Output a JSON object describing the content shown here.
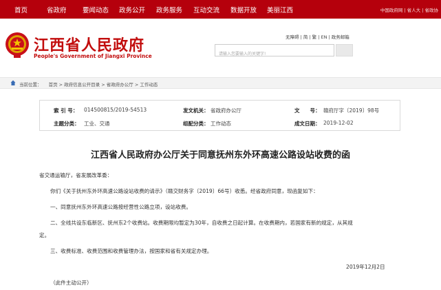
{
  "top_nav": {
    "items": [
      "首页",
      "省政府",
      "要闻动态",
      "政务公开",
      "政务服务",
      "互动交流",
      "数据开放",
      "美丽江西"
    ],
    "right_links": "中国政府网 | 省人大 | 省政协"
  },
  "header": {
    "title": "江西省人民政府",
    "subtitle": "People's Government of Jiangxi Province",
    "utility_links": "无障碍 | 简 | 繁 | EN | 政务邮箱",
    "search_placeholder": "请输入您要输入的关键字!"
  },
  "breadcrumb": {
    "prefix": "当前位置：",
    "items": [
      "首页",
      "政府信息公开目录",
      "省政府办公厅",
      "工作动态"
    ],
    "separator": " > "
  },
  "meta": {
    "index_label": "索 引 号：",
    "index_value": "014500815/2019-54513",
    "org_label": "发文机关：",
    "org_value": "省政府办公厅",
    "docno_label": "文　　号：",
    "docno_value": "赣府厅字〔2019〕98号",
    "topic_label": "主题分类：",
    "topic_value": "工业、交通",
    "category_label": "组配分类：",
    "category_value": "工作动态",
    "date_label": "成文日期：",
    "date_value": "2019-12-02"
  },
  "article": {
    "title": "江西省人民政府办公厅关于同意抚州东外环高速公路设站收费的函",
    "addressee": "省交通运输厅，省发展改革委：",
    "para1": "你们《关于抚州东外环高速公路设站收费的请示》（赣交财务字〔2019〕66号）收悉。经省政府同意，现函复如下：",
    "para2": "一、同意抚州东外环高速公路按经营性公路立项，设站收费。",
    "para3_line1": "二、全线共设东临新区、抚州东2个收费站。收费期限均暂定为30年，自收费之日起计算。在收费期内，若国家有新的规定，从其规",
    "para3_line2": "定。",
    "para4": "三、收费标准、收费范围和收费管理办法，按国家和省有关规定办理。",
    "date": "2019年12月2日",
    "note": "（此件主动公开）"
  },
  "colors": {
    "nav_red": "#b5000c",
    "title_red": "#c20d0d"
  }
}
